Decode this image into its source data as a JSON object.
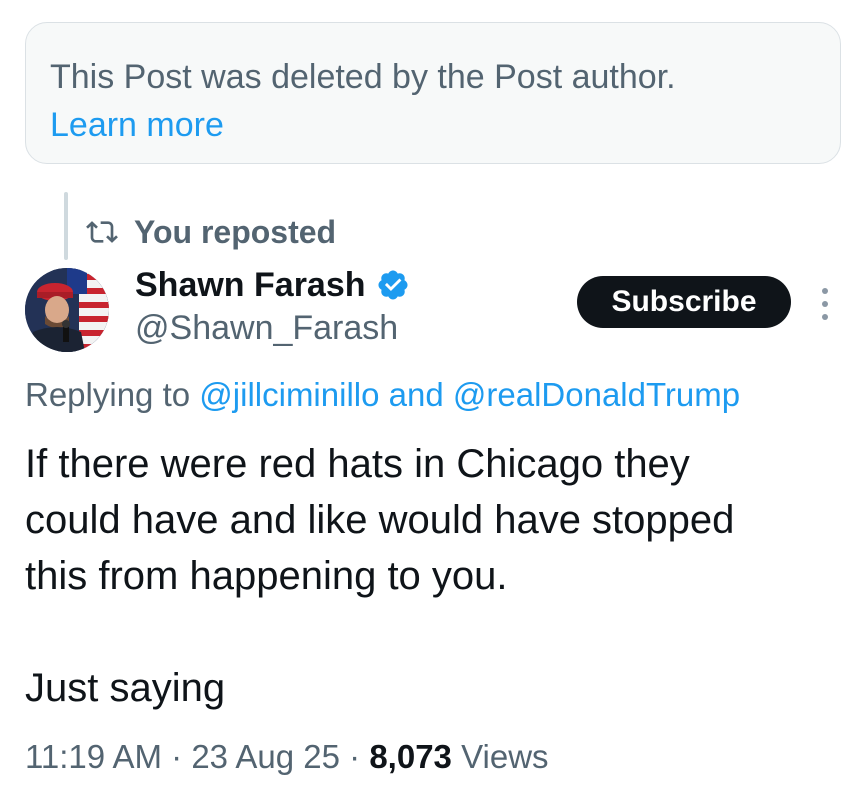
{
  "deleted_notice": {
    "text": "This Post was deleted by the Post author.",
    "link": "Learn more"
  },
  "repost": {
    "icon": "repost-icon",
    "label": "You reposted"
  },
  "author": {
    "name": "Shawn Farash",
    "handle": "@Shawn_Farash",
    "verified": true,
    "verified_color": "#1d9bf0"
  },
  "actions": {
    "subscribe_label": "Subscribe",
    "more_icon": "more-vertical-icon"
  },
  "reply_context": {
    "prefix": "Replying to",
    "mention_1": "@jillciminillo",
    "conjunction": "and",
    "mention_2": "@realDonaldTrump"
  },
  "tweet": {
    "lines": [
      "If there were red hats in Chicago they",
      "could have and like would have stopped",
      "this from happening to you."
    ],
    "last_line": "Just saying"
  },
  "meta": {
    "time": "11:19 AM",
    "separator": "·",
    "date": "23 Aug 25",
    "views_count": "8,073",
    "views_label": "Views"
  },
  "colors": {
    "accent": "#1d9bf0",
    "text_primary": "#0f1419",
    "text_secondary": "#536471"
  }
}
